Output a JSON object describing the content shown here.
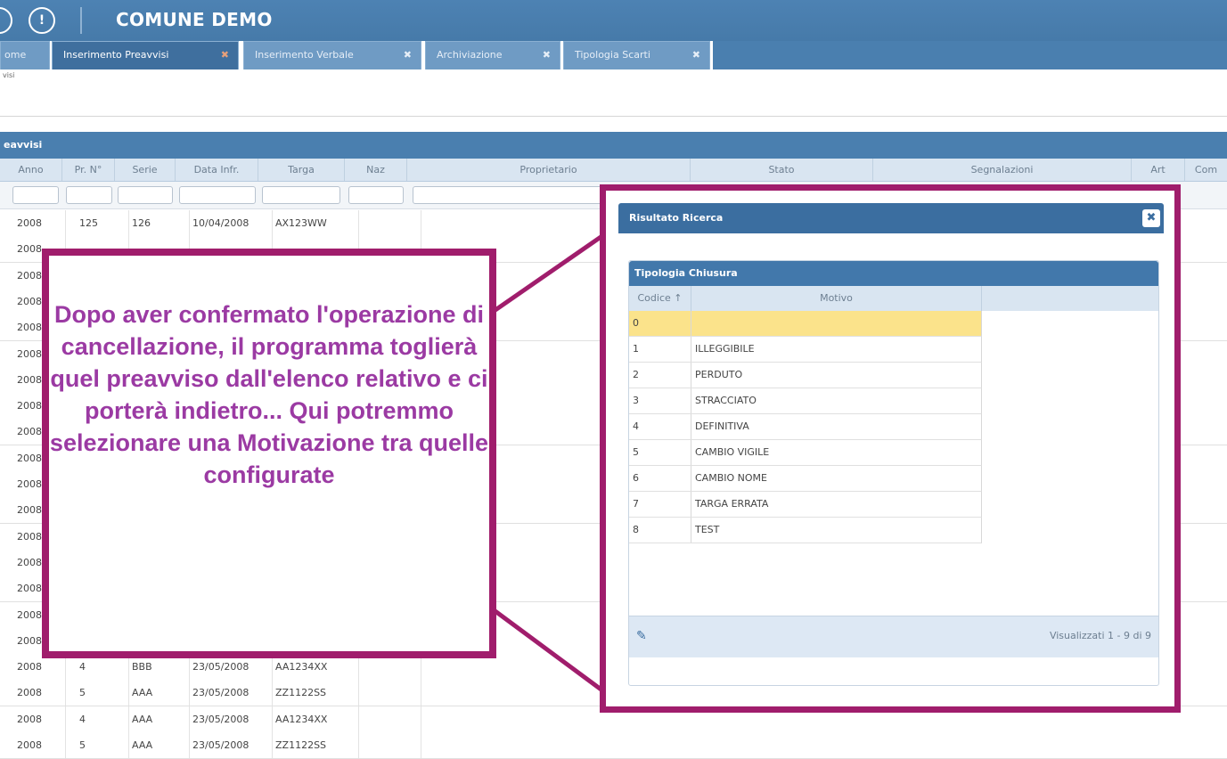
{
  "app": {
    "title": "COMUNE DEMO",
    "info_icon": "info-icon"
  },
  "tabs": [
    {
      "label": "ome"
    },
    {
      "label": "Inserimento Preavvisi",
      "close": "✖"
    },
    {
      "label": "Inserimento Verbale",
      "close": "✖"
    },
    {
      "label": "Archiviazione",
      "close": "✖"
    },
    {
      "label": "Tipologia Scarti",
      "close": "✖"
    }
  ],
  "breadcrumb": "visi",
  "grid": {
    "title": "eavvisi",
    "columns": [
      "Anno",
      "Pr. N°",
      "Serie",
      "Data Infr.",
      "Targa",
      "Naz",
      "Proprietario",
      "Stato",
      "Segnalazioni",
      "Art",
      "Com"
    ],
    "rows": [
      [
        "2008",
        "125",
        "126",
        "10/04/2008",
        "AX123WW",
        ""
      ],
      [
        "2008",
        "",
        "",
        "",
        "",
        ""
      ],
      [
        "2008",
        "",
        "",
        "",
        "",
        ""
      ],
      [
        "2008",
        "",
        "",
        "",
        "",
        ""
      ],
      [
        "2008",
        "",
        "",
        "",
        "",
        ""
      ],
      [
        "2008",
        "",
        "",
        "",
        "",
        ""
      ],
      [
        "2008",
        "",
        "",
        "",
        "",
        ""
      ],
      [
        "2008",
        "",
        "",
        "",
        "",
        ""
      ],
      [
        "2008",
        "",
        "",
        "",
        "",
        ""
      ],
      [
        "2008",
        "",
        "",
        "",
        "",
        ""
      ],
      [
        "2008",
        "",
        "",
        "",
        "",
        ""
      ],
      [
        "2008",
        "",
        "",
        "",
        "",
        ""
      ],
      [
        "2008",
        "",
        "",
        "",
        "",
        ""
      ],
      [
        "2008",
        "",
        "",
        "",
        "",
        ""
      ],
      [
        "2008",
        "",
        "",
        "",
        "",
        ""
      ],
      [
        "2008",
        "",
        "",
        "",
        "",
        ""
      ],
      [
        "2008",
        "",
        "",
        "",
        "",
        ""
      ],
      [
        "2008",
        "4",
        "BBB",
        "23/05/2008",
        "AA1234XX",
        ""
      ],
      [
        "2008",
        "5",
        "AAA",
        "23/05/2008",
        "ZZ1122SS",
        ""
      ],
      [
        "2008",
        "4",
        "AAA",
        "23/05/2008",
        "AA1234XX",
        ""
      ],
      [
        "2008",
        "5",
        "AAA",
        "23/05/2008",
        "ZZ1122SS",
        ""
      ]
    ]
  },
  "callout": {
    "text": "Dopo aver confermato l'operazione di cancellazione, il programma toglierà quel preavviso dall'elenco relativo e ci porterà indietro... Qui potremmo selezionare una Motivazione tra quelle configurate",
    "color": "#9b3aa3",
    "border_color": "#a01d6c"
  },
  "dialog": {
    "title": "Risultato Ricerca",
    "close_label": "✖",
    "panel_title": "Tipologia Chiusura",
    "columns": [
      "Codice ↑",
      "Motivo"
    ],
    "rows": [
      {
        "code": "0",
        "motivo": ""
      },
      {
        "code": "1",
        "motivo": "ILLEGGIBILE"
      },
      {
        "code": "2",
        "motivo": "PERDUTO"
      },
      {
        "code": "3",
        "motivo": "STRACCIATO"
      },
      {
        "code": "4",
        "motivo": "DEFINITIVA"
      },
      {
        "code": "5",
        "motivo": "CAMBIO VIGILE"
      },
      {
        "code": "6",
        "motivo": "CAMBIO NOME"
      },
      {
        "code": "7",
        "motivo": "TARGA ERRATA"
      },
      {
        "code": "8",
        "motivo": "TEST"
      }
    ],
    "pager": "Visualizzati 1 - 9 di 9"
  }
}
